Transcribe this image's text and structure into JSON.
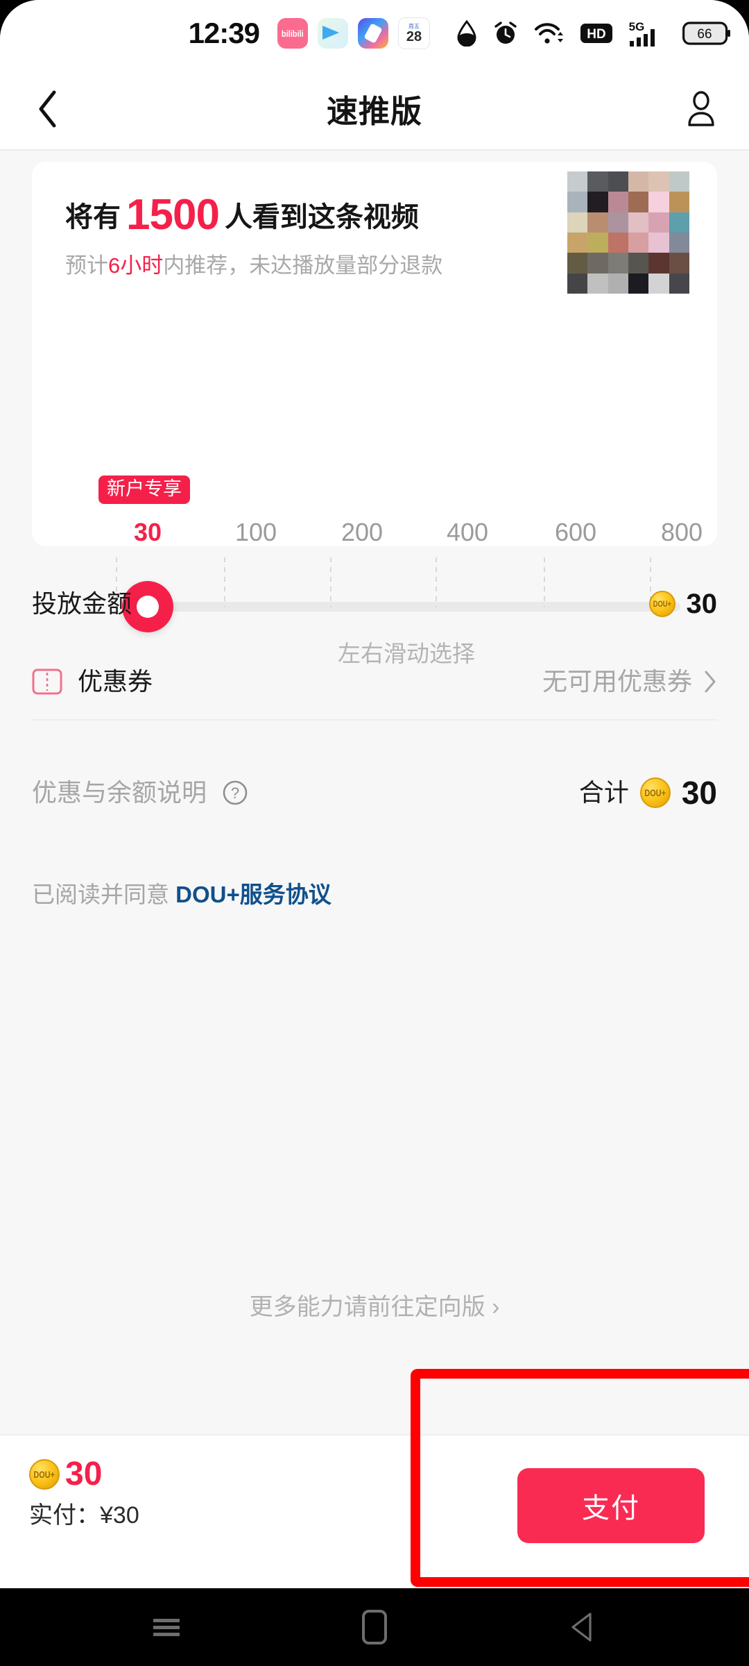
{
  "status_bar": {
    "time": "12:39",
    "app_icons": [
      {
        "name": "bilibili-icon",
        "label": "bilibili"
      },
      {
        "name": "paper-plane-icon",
        "label": ""
      },
      {
        "name": "gradient-app-icon",
        "label": ""
      },
      {
        "name": "calendar-icon",
        "weekday": "周五",
        "day": "28"
      }
    ],
    "indicators": [
      {
        "name": "water-drop-icon"
      },
      {
        "name": "alarm-clock-icon"
      },
      {
        "name": "wifi-icon"
      },
      {
        "name": "hd-icon",
        "label": "HD"
      },
      {
        "name": "signal-5g-icon",
        "label": "5G"
      },
      {
        "name": "battery-icon",
        "level": "66"
      }
    ]
  },
  "header": {
    "back_label": "返回",
    "title": "速推版",
    "profile_label": "我的"
  },
  "promo": {
    "prefix": "将有",
    "views": "1500",
    "suffix": "人看到这条视频",
    "sub_prefix": "预计",
    "sub_highlight": "6小时",
    "sub_suffix": "内推荐，未达播放量部分退款",
    "thumbnail_alt": "视频缩略图",
    "thumbnail_colors": [
      "#c6ccce",
      "#5a5b5e",
      "#4d4e51",
      "#d4b7a7",
      "#dcc3b4",
      "#bfc9c7",
      "#a9b3bc",
      "#211d23",
      "#b98a96",
      "#9e6b55",
      "#f7d0e0",
      "#bd9258",
      "#dcd5bb",
      "#ba8d71",
      "#ab94a0",
      "#e2bfc4",
      "#d7a2b2",
      "#5e9fae",
      "#c9a468",
      "#bcae5d",
      "#bf7266",
      "#d79fa0",
      "#e6c2d2",
      "#828a99",
      "#635c45",
      "#6e6963",
      "#7d7c76",
      "#56554f",
      "#5b3630",
      "#6b4e44",
      "#454548",
      "#c0c0c0",
      "#b0b0b0",
      "#1b1b22",
      "#d3d3d3",
      "#46464b"
    ]
  },
  "slider": {
    "badge": "新户专享",
    "ticks": [
      "30",
      "100",
      "200",
      "400",
      "600",
      "800"
    ],
    "selected_value": "30",
    "hint": "左右滑动选择",
    "accent_color": "#f5204a"
  },
  "rows": {
    "budget_label": "投放金额",
    "budget_value": "30",
    "coupon_label": "优惠券",
    "coupon_value": "无可用优惠券",
    "coupon_chevron": "›",
    "explain_label": "优惠与余额说明",
    "total_label": "合计",
    "total_value": "30"
  },
  "agreement": {
    "prefix": "已阅读并同意 ",
    "link": "DOU+服务协议"
  },
  "more_link": {
    "text": "更多能力请前往定向版",
    "chevron": "›"
  },
  "paybar": {
    "amount": "30",
    "actual_paid": "实付：¥30",
    "pay_button": "支付",
    "button_color": "#fa2b53"
  },
  "annotation": {
    "name": "red-highlight-box",
    "color": "#ff0000"
  },
  "nav_bar": {
    "recents_label": "最近任务",
    "home_label": "主页",
    "back_label": "返回"
  }
}
